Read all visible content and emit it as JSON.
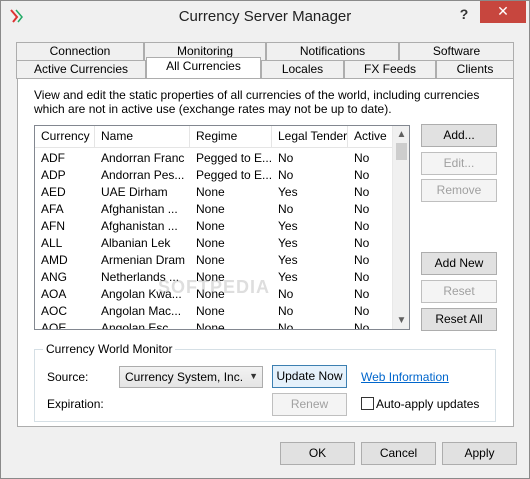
{
  "window": {
    "title": "Currency Server Manager",
    "help_label": "?",
    "close_label": "✕"
  },
  "tabs": {
    "row1": [
      "Connection",
      "Monitoring",
      "Notifications",
      "Software"
    ],
    "row2": [
      "Active Currencies",
      "All Currencies",
      "Locales",
      "FX Feeds",
      "Clients"
    ],
    "selected": "All Currencies"
  },
  "panel": {
    "description": "View and edit the static properties of all currencies of the world, including currencies which are not in active use (exchange rates may not be up to date)."
  },
  "list": {
    "columns": [
      "Currency",
      "Name",
      "Regime",
      "Legal Tender",
      "Active"
    ],
    "rows": [
      [
        "ADF",
        "Andorran Franc",
        "Pegged to E...",
        "No",
        "No"
      ],
      [
        "ADP",
        "Andorran Pes...",
        "Pegged to E...",
        "No",
        "No"
      ],
      [
        "AED",
        "UAE Dirham",
        "None",
        "Yes",
        "No"
      ],
      [
        "AFA",
        "Afghanistan ...",
        "None",
        "No",
        "No"
      ],
      [
        "AFN",
        "Afghanistan ...",
        "None",
        "Yes",
        "No"
      ],
      [
        "ALL",
        "Albanian Lek",
        "None",
        "Yes",
        "No"
      ],
      [
        "AMD",
        "Armenian Dram",
        "None",
        "Yes",
        "No"
      ],
      [
        "ANG",
        "Netherlands ...",
        "None",
        "Yes",
        "No"
      ],
      [
        "AOA",
        "Angolan Kwa...",
        "None",
        "No",
        "No"
      ],
      [
        "AOC",
        "Angolan Mac...",
        "None",
        "No",
        "No"
      ],
      [
        "AOE",
        "Angolan Esc...",
        "None",
        "No",
        "No"
      ]
    ]
  },
  "side_buttons": {
    "add": "Add...",
    "edit": "Edit...",
    "remove": "Remove",
    "add_new": "Add New",
    "reset": "Reset",
    "reset_all": "Reset All"
  },
  "monitor": {
    "title": "Currency World Monitor",
    "source_label": "Source:",
    "source_value": "Currency System, Inc.",
    "update_now": "Update Now",
    "web_information": "Web Information",
    "expiration_label": "Expiration:",
    "renew": "Renew",
    "auto_apply": "Auto-apply updates"
  },
  "footer": {
    "ok": "OK",
    "cancel": "Cancel",
    "apply": "Apply"
  },
  "watermark": "SOFTPEDIA",
  "colors": {
    "close_button": "#c7463e",
    "link": "#0066cc",
    "focus_border": "#3c7fb1"
  }
}
